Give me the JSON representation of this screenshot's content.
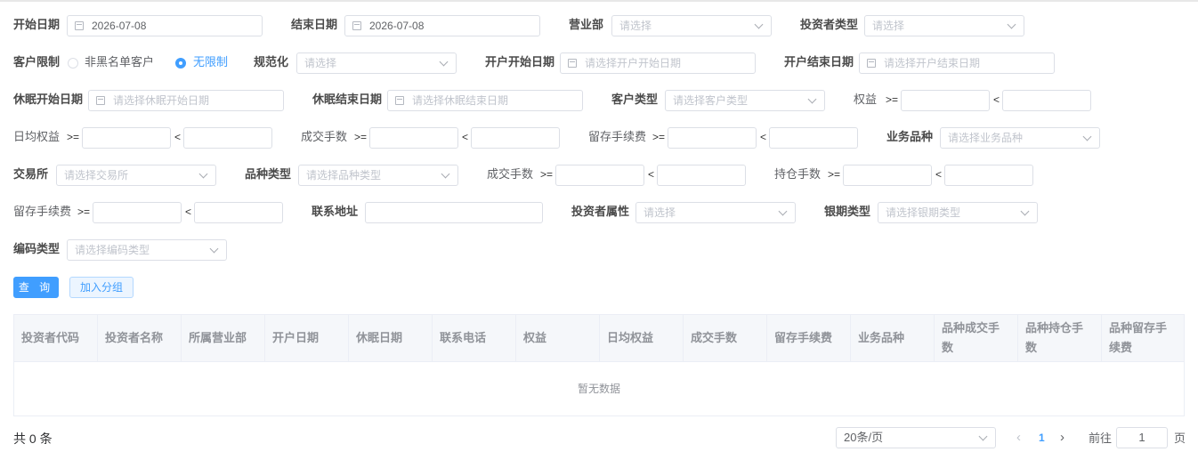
{
  "filters": {
    "start_date_label": "开始日期",
    "start_date_value": "2026-07-08",
    "end_date_label": "结束日期",
    "end_date_value": "2026-07-08",
    "branch_label": "营业部",
    "branch_placeholder": "请选择",
    "investor_type_label": "投资者类型",
    "investor_type_placeholder": "请选择",
    "customer_limit_label": "客户限制",
    "customer_limit_options": [
      "非黑名单客户",
      "无限制"
    ],
    "customer_limit_selected": "无限制",
    "normalize_label": "规范化",
    "normalize_placeholder": "请选择",
    "open_start_label": "开户开始日期",
    "open_start_placeholder": "请选择开户开始日期",
    "open_end_label": "开户结束日期",
    "open_end_placeholder": "请选择开户结束日期",
    "dormant_start_label": "休眠开始日期",
    "dormant_start_placeholder": "请选择休眠开始日期",
    "dormant_end_label": "休眠结束日期",
    "dormant_end_placeholder": "请选择休眠结束日期",
    "customer_type_label": "客户类型",
    "customer_type_placeholder": "请选择客户类型",
    "equity_label": "权益",
    "daily_equity_label": "日均权益",
    "volume_label": "成交手数",
    "retained_fee_label": "留存手续费",
    "business_variety_label": "业务品种",
    "business_variety_placeholder": "请选择业务品种",
    "exchange_label": "交易所",
    "exchange_placeholder": "请选择交易所",
    "variety_type_label": "品种类型",
    "variety_type_placeholder": "请选择品种类型",
    "volume2_label": "成交手数",
    "position_label": "持仓手数",
    "retained_fee2_label": "留存手续费",
    "address_label": "联系地址",
    "investor_attr_label": "投资者属性",
    "investor_attr_placeholder": "请选择",
    "bank_type_label": "银期类型",
    "bank_type_placeholder": "请选择银期类型",
    "code_type_label": "编码类型",
    "code_type_placeholder": "请选择编码类型",
    "op_gte": ">=",
    "op_lt": "<"
  },
  "actions": {
    "query_label": "查 询",
    "add_group_label": "加入分组"
  },
  "table": {
    "columns": [
      "投资者代码",
      "投资者名称",
      "所属营业部",
      "开户日期",
      "休眠日期",
      "联系电话",
      "权益",
      "日均权益",
      "成交手数",
      "留存手续费",
      "业务品种",
      "品种成交手数",
      "品种持仓手数",
      "品种留存手续费"
    ],
    "empty_text": "暂无数据"
  },
  "pagination": {
    "total_text": "共 0 条",
    "page_size": "20条/页",
    "current_page": "1",
    "goto_label": "前往",
    "goto_value": "1",
    "page_unit": "页"
  },
  "colors": {
    "accent": "#409eff"
  }
}
